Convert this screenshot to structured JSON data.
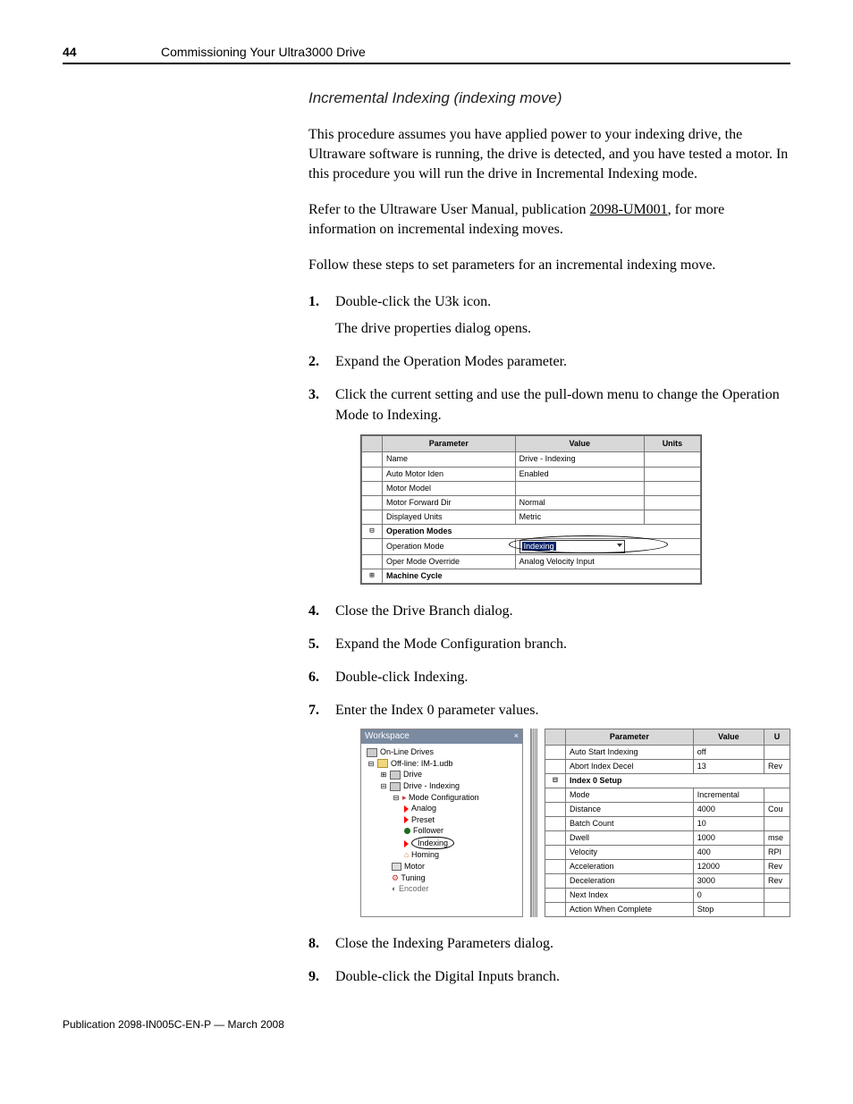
{
  "header": {
    "page_number": "44",
    "title": "Commissioning Your Ultra3000 Drive"
  },
  "section_heading": "Incremental Indexing (indexing move)",
  "para1": "This procedure assumes you have applied power to your indexing drive, the Ultraware software is running, the drive is detected, and you have tested a motor. In this procedure you will run the drive in Incremental Indexing mode.",
  "para2_pre": "Refer to the Ultraware User Manual, publication ",
  "para2_link": "2098-UM001",
  "para2_post": ", for more information on incremental indexing moves.",
  "para3": "Follow these steps to set parameters for an incremental indexing move.",
  "steps": {
    "s1": "Double-click the U3k icon.",
    "s1b": "The drive properties dialog opens.",
    "s2": "Expand the Operation Modes parameter.",
    "s3": "Click the current setting and use the pull-down menu to change the Operation Mode to Indexing.",
    "s4": "Close the Drive Branch dialog.",
    "s5": "Expand the Mode Configuration branch.",
    "s6": "Double-click Indexing.",
    "s7": "Enter the Index 0 parameter values.",
    "s8": "Close the Indexing Parameters dialog.",
    "s9": "Double-click the Digital Inputs branch."
  },
  "table1": {
    "headers": {
      "param": "Parameter",
      "value": "Value",
      "units": "Units"
    },
    "rows": [
      {
        "param": "Name",
        "value": "Drive - Indexing",
        "units": ""
      },
      {
        "param": "Auto Motor Iden",
        "value": "Enabled",
        "units": ""
      },
      {
        "param": "Motor Model",
        "value": "",
        "units": ""
      },
      {
        "param": "Motor Forward Dir",
        "value": "Normal",
        "units": ""
      },
      {
        "param": "Displayed Units",
        "value": "Metric",
        "units": ""
      }
    ],
    "section1": "Operation Modes",
    "op_mode_label": "Operation Mode",
    "op_mode_selected": "Indexing",
    "override_label": "Oper Mode Override",
    "override_value": "Analog Velocity Input",
    "section2": "Machine Cycle"
  },
  "workspace": {
    "title": "Workspace",
    "tree": {
      "online": "On-Line Drives",
      "offline": "Off-line: IM-1.udb",
      "drive": "Drive",
      "drive_indexing": "Drive - Indexing",
      "mode_config": "Mode Configuration",
      "analog": "Analog",
      "preset": "Preset",
      "follower": "Follower",
      "indexing": "Indexing",
      "homing": "Homing",
      "motor": "Motor",
      "tuning": "Tuning",
      "encoder": "Encoder"
    }
  },
  "table2": {
    "headers": {
      "param": "Parameter",
      "value": "Value",
      "units": "U"
    },
    "rows_top": [
      {
        "param": "Auto Start Indexing",
        "value": "off",
        "units": ""
      },
      {
        "param": "Abort Index Decel",
        "value": "13",
        "units": "Rev"
      }
    ],
    "section": "Index 0 Setup",
    "rows_body": [
      {
        "param": "Mode",
        "value": "Incremental",
        "units": ""
      },
      {
        "param": "Distance",
        "value": "4000",
        "units": "Cou"
      },
      {
        "param": "Batch Count",
        "value": "10",
        "units": ""
      },
      {
        "param": "Dwell",
        "value": "1000",
        "units": "mse"
      },
      {
        "param": "Velocity",
        "value": "400",
        "units": "RPI"
      },
      {
        "param": "Acceleration",
        "value": "12000",
        "units": "Rev"
      },
      {
        "param": "Deceleration",
        "value": "3000",
        "units": "Rev"
      },
      {
        "param": "Next Index",
        "value": "0",
        "units": ""
      },
      {
        "param": "Action When Complete",
        "value": "Stop",
        "units": ""
      }
    ]
  },
  "footer": "Publication 2098-IN005C-EN-P — March 2008"
}
